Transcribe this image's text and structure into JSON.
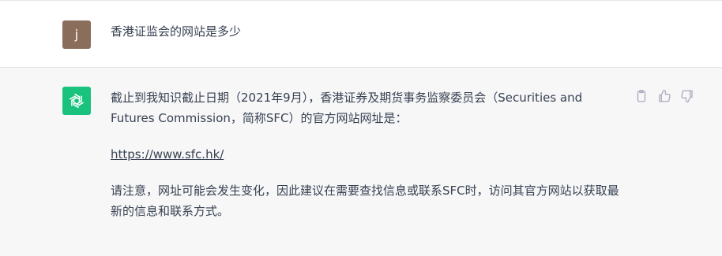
{
  "user_message": {
    "avatar_initial": "j",
    "text": "香港证监会的网站是多少"
  },
  "assistant_message": {
    "paragraph_1": "截止到我知识截止日期（2021年9月），香港证券及期货事务监察委员会（Securities and Futures Commission，简称SFC）的官方网站网址是：",
    "link_text": "https://www.sfc.hk/",
    "paragraph_3": "请注意，网址可能会发生变化，因此建议在需要查找信息或联系SFC时，访问其官方网站以获取最新的信息和联系方式。"
  },
  "actions": {
    "icons": [
      "clipboard-icon",
      "thumbs-up-icon",
      "thumbs-down-icon"
    ]
  },
  "colors": {
    "user_avatar": "#8b6d5c",
    "assistant_avatar": "#19c37d",
    "assistant_bg": "#f7f7f8",
    "text": "#374151"
  }
}
